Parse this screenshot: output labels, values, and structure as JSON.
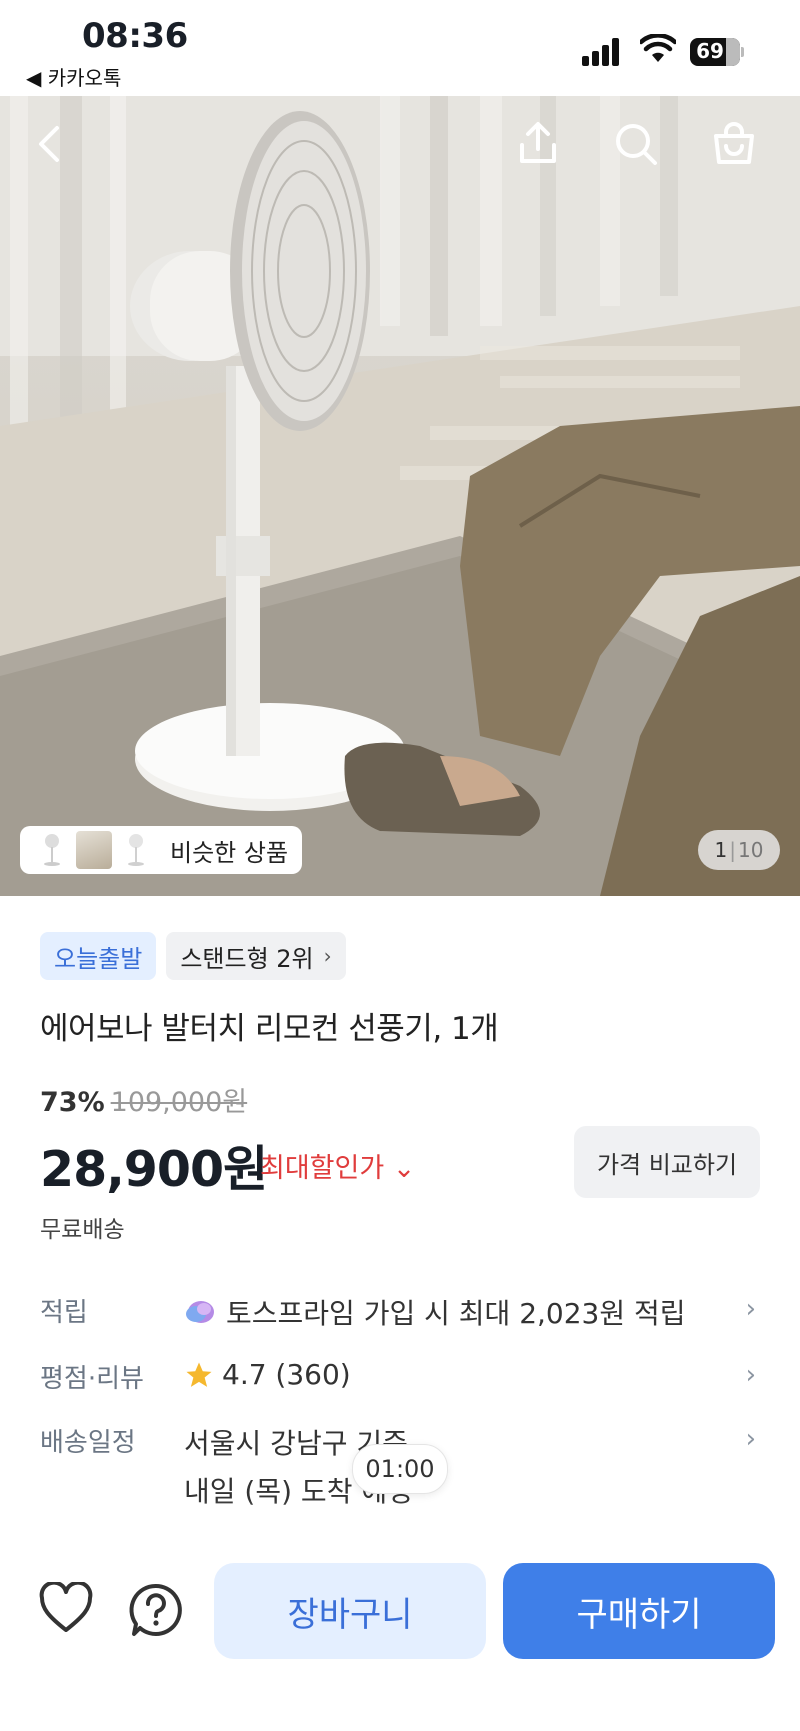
{
  "status_bar": {
    "time": "08:36",
    "back_app": "◀ 카카오톡",
    "battery": "69"
  },
  "hero": {
    "similar_label": "비슷한 상품",
    "counter_current": "1",
    "counter_separator": "|",
    "counter_total": "10",
    "icons": [
      "back-icon",
      "share-icon",
      "search-icon",
      "cart-icon"
    ]
  },
  "product": {
    "chip_today": "오늘출발",
    "chip_rank": "스탠드형 2위",
    "chip_rank_chevron": "›",
    "title": "에어보나 발터치 리모컨 선풍기, 1개",
    "discount_rate": "73%",
    "original_price": "109,000원",
    "price": "28,900원",
    "max_discount": "최대할인가 ⌄",
    "compare_button": "가격 비교하기",
    "shipping": "무료배송"
  },
  "info": {
    "points_label": "적립",
    "points_value": "토스프라임 가입 시 최대 2,023원 적립",
    "rating_label": "평점·리뷰",
    "rating_value": "4.7 (360)",
    "delivery_label": "배송일정",
    "delivery_line1": "서울시 강남구 기준",
    "delivery_line2": "내일 (목) 도착 예정",
    "arrow": "›"
  },
  "timer_badge": "01:00",
  "bottom": {
    "cart_button": "장바구니",
    "buy_button": "구매하기"
  },
  "colors": {
    "accent": "#3f7fe8",
    "accent_light": "#e4efff",
    "sale_red": "#e03c3c",
    "star": "#f5b82e"
  }
}
